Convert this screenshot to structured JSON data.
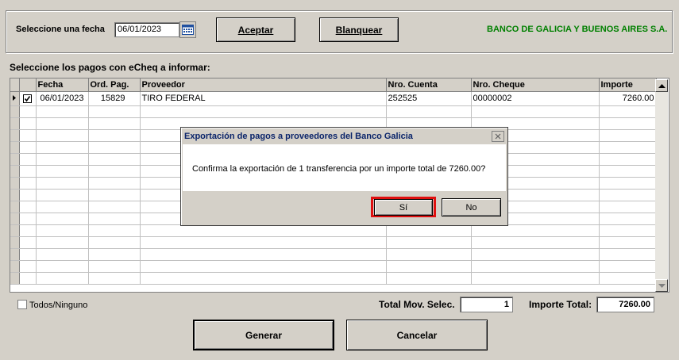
{
  "top": {
    "date_label": "Seleccione una fecha",
    "date_value": "06/01/2023",
    "accept_label": "Aceptar",
    "clear_label": "Blanquear",
    "bank_name": "BANCO DE GALICIA Y BUENOS AIRES  S.A."
  },
  "section_label": "Seleccione los pagos con eCheq a informar:",
  "grid": {
    "headers": [
      "Fecha",
      "Ord. Pag.",
      "Proveedor",
      "Nro. Cuenta",
      "Nro. Cheque",
      "Importe"
    ],
    "rows": [
      {
        "fecha": "06/01/2023",
        "ord_pag": "15829",
        "proveedor": "TIRO FEDERAL",
        "nro_cuenta": "252525",
        "nro_cheque": "00000002",
        "importe": "7260.00",
        "checked": true
      }
    ]
  },
  "footer": {
    "all_none_label": "Todos/Ninguno",
    "total_mov_label": "Total Mov. Selec.",
    "total_mov_value": "1",
    "total_amount_label": "Importe Total:",
    "total_amount_value": "7260.00",
    "generate_label": "Generar",
    "cancel_label": "Cancelar"
  },
  "dialog": {
    "title": "Exportación de pagos a proveedores del Banco Galicia",
    "message": "Confirma la exportación de 1 transferencia por un importe total de 7260.00?",
    "yes_label": "Sí",
    "no_label": "No"
  },
  "colors": {
    "bank_name": "#008000",
    "dialog_title_bg": "#0a246a",
    "highlight": "#e01010"
  }
}
